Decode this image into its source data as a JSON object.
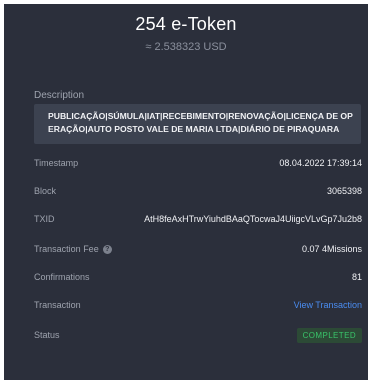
{
  "header": {
    "amount": "254 e-Token",
    "usd": "≈ 2.538323 USD"
  },
  "description": {
    "label": "Description",
    "text": "PUBLICAÇÃO|SÚMULA|IAT|RECEBIMENTO|RENOVAÇÃO|LICENÇA DE OPERAÇÃO|AUTO POSTO VALE DE MARIA LTDA|DIÁRIO DE PIRAQUARA"
  },
  "details": {
    "timestamp": {
      "label": "Timestamp",
      "value": "08.04.2022 17:39:14"
    },
    "block": {
      "label": "Block",
      "value": "3065398"
    },
    "txid": {
      "label": "TXID",
      "value": "AtH8feAxHTrwYiuhdBAaQTocwaJ4UiigcVLvGp7Ju2b8"
    },
    "fee": {
      "label": "Transaction Fee",
      "value": "0.07 4Missions",
      "icon": "question-icon"
    },
    "confirmations": {
      "label": "Confirmations",
      "value": "81"
    },
    "transaction": {
      "label": "Transaction",
      "value": "View Transaction"
    },
    "status": {
      "label": "Status",
      "value": "COMPLETED"
    }
  },
  "colors": {
    "panel_bg": "#2b2f3b",
    "desc_bg": "#3c4250",
    "link": "#4a8cf0",
    "status_text": "#39c46a",
    "status_bg": "#2c4a36"
  }
}
